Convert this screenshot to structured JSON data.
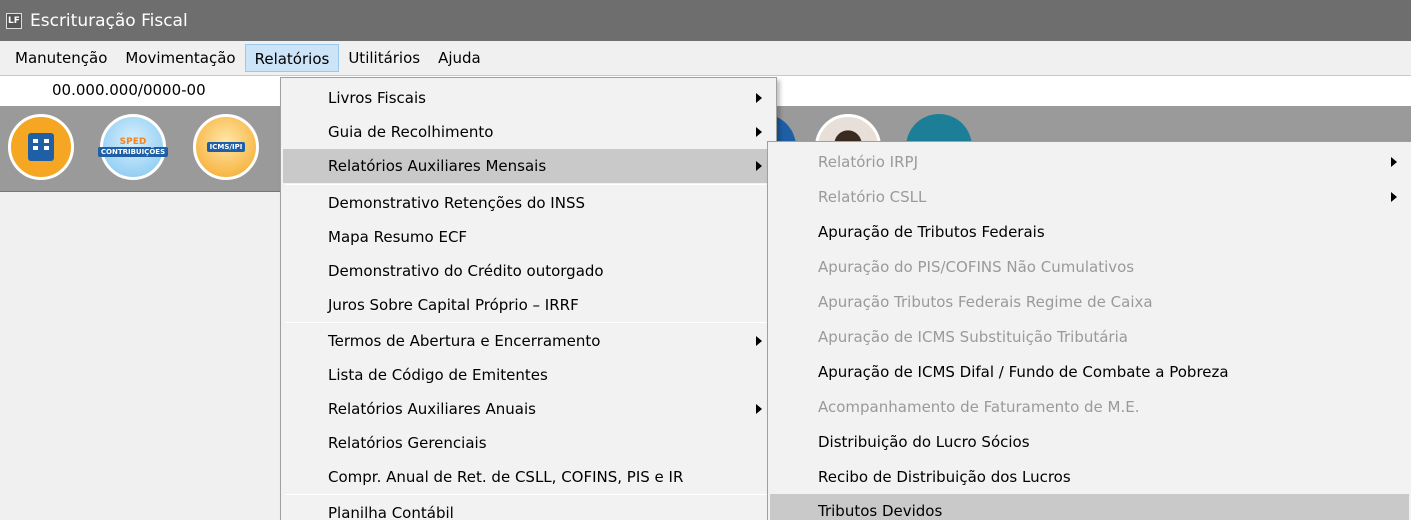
{
  "window": {
    "title": "Escrituração Fiscal",
    "icon": "LF"
  },
  "menubar": [
    "Manutenção",
    "Movimentação",
    "Relatórios",
    "Utilitários",
    "Ajuda"
  ],
  "cnpj": "00.000.000/0000-00",
  "toolbar": {
    "sped_top": "SPED",
    "sped_band": "CONTRIBUIÇÕES",
    "icms_band": "ICMS/IPI"
  },
  "relatorios_menu": [
    "Livros Fiscais",
    "Guia de Recolhimento",
    "Relatórios Auxiliares Mensais",
    "Demonstrativo Retenções do INSS",
    "Mapa Resumo ECF",
    "Demonstrativo do Crédito outorgado",
    "Juros Sobre Capital Próprio – IRRF",
    "Termos de Abertura e Encerramento",
    "Lista de Código de Emitentes",
    "Relatórios Auxiliares Anuais",
    "Relatórios Gerenciais",
    "Compr. Anual de Ret. de CSLL, COFINS,  PIS e IR",
    "Planilha Contábil"
  ],
  "submenu": [
    "Relatório IRPJ",
    "Relatório CSLL",
    "Apuração de Tributos Federais",
    "Apuração do PIS/COFINS Não Cumulativos",
    "Apuração Tributos Federais Regime de Caixa",
    "Apuração de ICMS Substituição Tributária",
    "Apuração de ICMS Difal / Fundo de Combate a Pobreza",
    "Acompanhamento de Faturamento de M.E.",
    "Distribuição do Lucro Sócios",
    "Recibo de Distribuição dos Lucros",
    "Tributos Devidos"
  ]
}
